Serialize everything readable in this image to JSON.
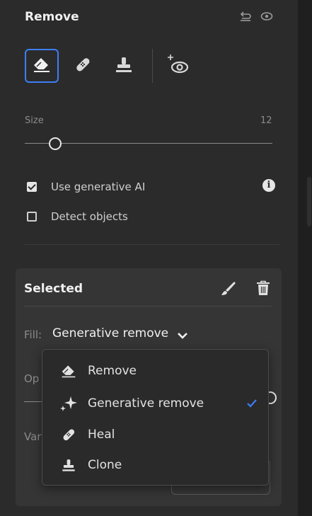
{
  "panel": {
    "title": "Remove",
    "header_icons": [
      "reset-icon",
      "eye-icon"
    ],
    "tools": [
      {
        "name": "remove",
        "icon": "eraser-icon",
        "active": true
      },
      {
        "name": "heal",
        "icon": "bandage-icon",
        "active": false
      },
      {
        "name": "clone",
        "icon": "stamp-icon",
        "active": false
      },
      {
        "name": "visualize",
        "icon": "eye-plus-icon",
        "active": false
      }
    ],
    "size": {
      "label": "Size",
      "value": "12"
    },
    "options": {
      "use_generative_ai": {
        "label": "Use generative AI",
        "checked": true
      },
      "detect_objects": {
        "label": "Detect objects",
        "checked": false
      }
    }
  },
  "selected": {
    "title": "Selected",
    "fill_label": "Fill:",
    "fill_value": "Generative remove",
    "opacity_label": "Op",
    "variations_label": "Var"
  },
  "fill_menu": {
    "items": [
      {
        "label": "Remove",
        "icon": "eraser-icon",
        "checked": false
      },
      {
        "label": "Generative remove",
        "icon": "sparkle-icon",
        "checked": true
      },
      {
        "label": "Heal",
        "icon": "bandage-icon",
        "checked": false
      },
      {
        "label": "Clone",
        "icon": "stamp-icon",
        "checked": false
      }
    ]
  },
  "colors": {
    "accent": "#3d7ef5",
    "panel_bg": "#2b2b2b",
    "card_bg": "#353535",
    "menu_bg": "#2a2a2a"
  }
}
